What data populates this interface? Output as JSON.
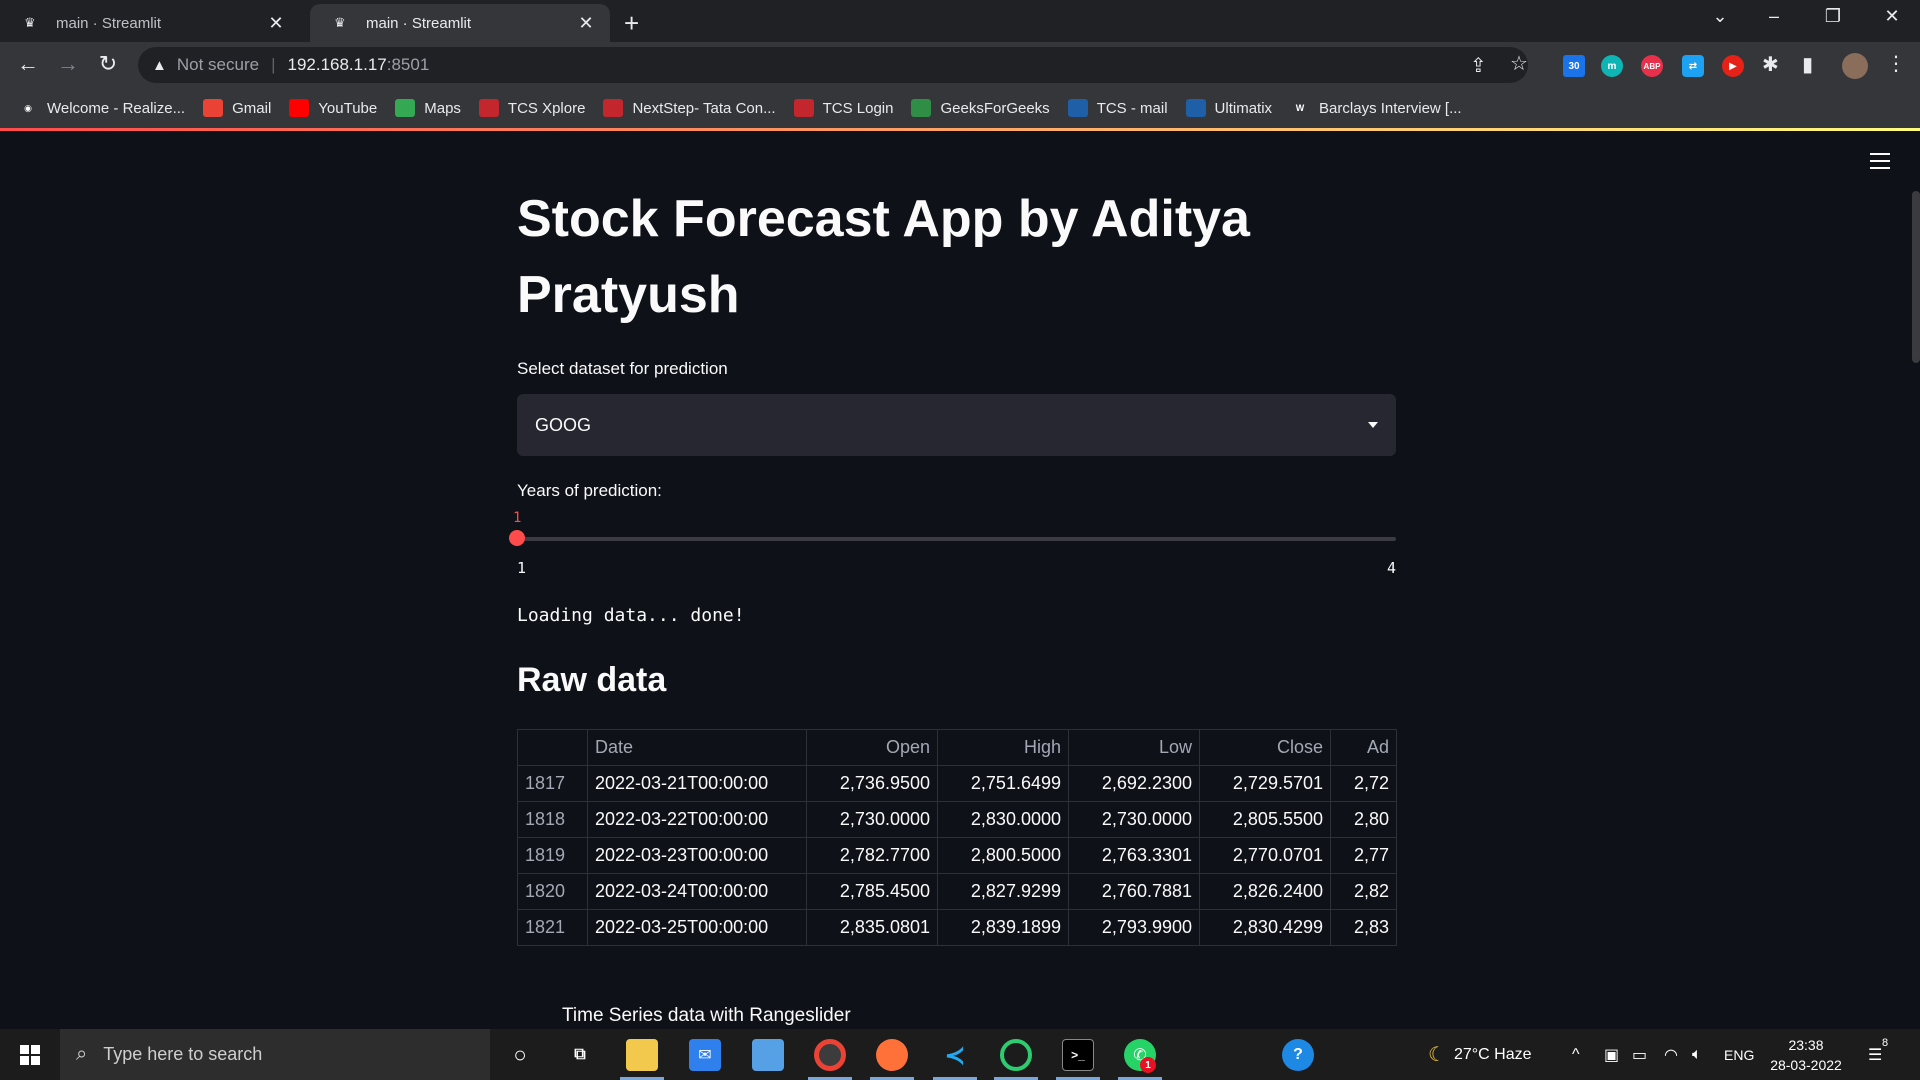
{
  "browser": {
    "tabs": [
      {
        "title": "main · Streamlit",
        "active": false
      },
      {
        "title": "main · Streamlit",
        "active": true
      }
    ],
    "address": {
      "security": "Not secure",
      "host": "192.168.1.17",
      "port": ":8501"
    },
    "extensions": [
      {
        "name": "calendar-ext",
        "badge": "30",
        "color": "#1a73e8"
      },
      {
        "name": "m-ext",
        "badge": "m",
        "color": "#0fb5b5"
      },
      {
        "name": "adblock-ext",
        "badge": "ABP",
        "color": "#e8304b"
      },
      {
        "name": "translate-ext",
        "badge": "",
        "color": "#1da1f2"
      },
      {
        "name": "youtube-ext",
        "badge": "",
        "color": "#e62117"
      }
    ],
    "bookmarks": [
      {
        "label": "Welcome - Realize...",
        "icon": "globe-icon",
        "color": "#ffffff"
      },
      {
        "label": "Gmail",
        "icon": "gmail-icon",
        "color": "#ea4335"
      },
      {
        "label": "YouTube",
        "icon": "youtube-icon",
        "color": "#ff0000"
      },
      {
        "label": "Maps",
        "icon": "maps-icon",
        "color": "#34a853"
      },
      {
        "label": "TCS Xplore",
        "icon": "tcs-icon",
        "color": "#c4262e"
      },
      {
        "label": "NextStep- Tata Con...",
        "icon": "tcs-icon",
        "color": "#c4262e"
      },
      {
        "label": "TCS Login",
        "icon": "tcs-icon",
        "color": "#c4262e"
      },
      {
        "label": "GeeksForGeeks",
        "icon": "gfg-icon",
        "color": "#2f8d46"
      },
      {
        "label": "TCS - mail",
        "icon": "tata-icon",
        "color": "#1f5fa8"
      },
      {
        "label": "Ultimatix",
        "icon": "tata-icon",
        "color": "#1f5fa8"
      },
      {
        "label": "Barclays Interview [...",
        "icon": "wikipedia-icon",
        "color": "#ffffff"
      }
    ]
  },
  "app": {
    "title": "Stock Forecast App by Aditya Pratyush",
    "select_label": "Select dataset for prediction",
    "selected_dataset": "GOOG",
    "slider_label": "Years of prediction:",
    "slider_value": "1",
    "slider_min": "1",
    "slider_max": "4",
    "loading_text": "Loading data... done!",
    "raw_data_heading": "Raw data",
    "chart_heading": "Time Series data with Rangeslider",
    "accent": "#ff4b4b"
  },
  "table": {
    "columns": [
      "",
      "Date",
      "Open",
      "High",
      "Low",
      "Close",
      "Ad"
    ],
    "rows": [
      [
        "1817",
        "2022-03-21T00:00:00",
        "2,736.9500",
        "2,751.6499",
        "2,692.2300",
        "2,729.5701",
        "2,72"
      ],
      [
        "1818",
        "2022-03-22T00:00:00",
        "2,730.0000",
        "2,830.0000",
        "2,730.0000",
        "2,805.5500",
        "2,80"
      ],
      [
        "1819",
        "2022-03-23T00:00:00",
        "2,782.7700",
        "2,800.5000",
        "2,763.3301",
        "2,770.0701",
        "2,77"
      ],
      [
        "1820",
        "2022-03-24T00:00:00",
        "2,785.4500",
        "2,827.9299",
        "2,760.7881",
        "2,826.2400",
        "2,82"
      ],
      [
        "1821",
        "2022-03-25T00:00:00",
        "2,835.0801",
        "2,839.1899",
        "2,793.9900",
        "2,830.4299",
        "2,83"
      ]
    ]
  },
  "taskbar": {
    "search_placeholder": "Type here to search",
    "weather": "27°C  Haze",
    "language": "ENG",
    "time": "23:38",
    "date": "28-03-2022",
    "notifications": "8",
    "whatsapp_badge": "1"
  }
}
